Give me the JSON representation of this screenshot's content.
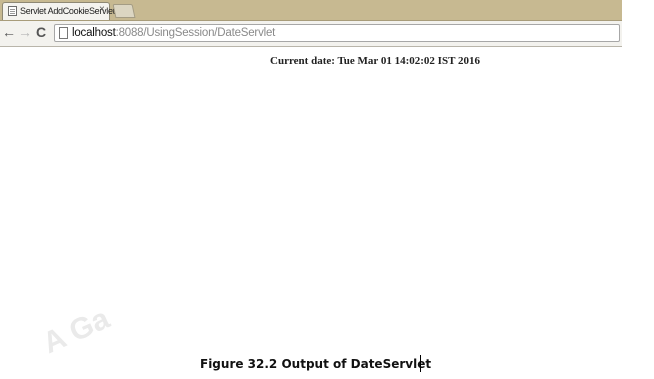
{
  "browser": {
    "tab": {
      "title": "Servlet AddCookieServlet",
      "close_glyph": "×",
      "favicon": "page-favicon-icon"
    },
    "toolbar": {
      "back_glyph": "←",
      "forward_glyph": "→",
      "reload_glyph": "C"
    },
    "address_bar": {
      "host": "localhost",
      "path": ":8088/UsingSession/DateServlet"
    }
  },
  "page": {
    "current_date_text": "Current date: Tue Mar 01 14:02:02 IST 2016"
  },
  "document": {
    "watermark_text": "A Ga",
    "caption": "Figure 32.2 Output of DateServlet"
  },
  "colors": {
    "tabstrip": "#c7b991",
    "toolbar": "#f3f2ee",
    "page_background": "#ffffff"
  }
}
